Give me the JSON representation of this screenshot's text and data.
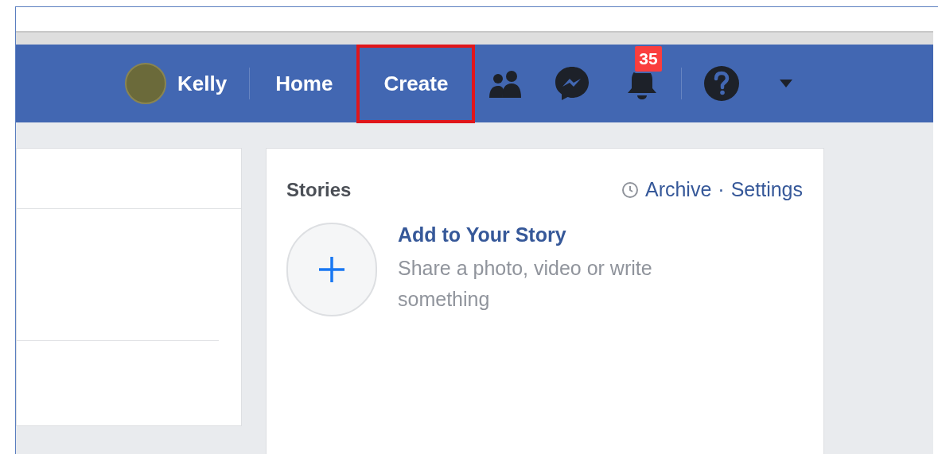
{
  "navbar": {
    "profile": {
      "name": "Kelly"
    },
    "links": [
      {
        "label": "Home",
        "highlighted": false
      },
      {
        "label": "Create",
        "highlighted": true
      }
    ],
    "notifications": {
      "count": "35"
    }
  },
  "stories": {
    "title": "Stories",
    "archive": "Archive",
    "separator": "·",
    "settings": "Settings",
    "add_title": "Add to Your Story",
    "add_subtitle": "Share a photo, video or write something"
  }
}
